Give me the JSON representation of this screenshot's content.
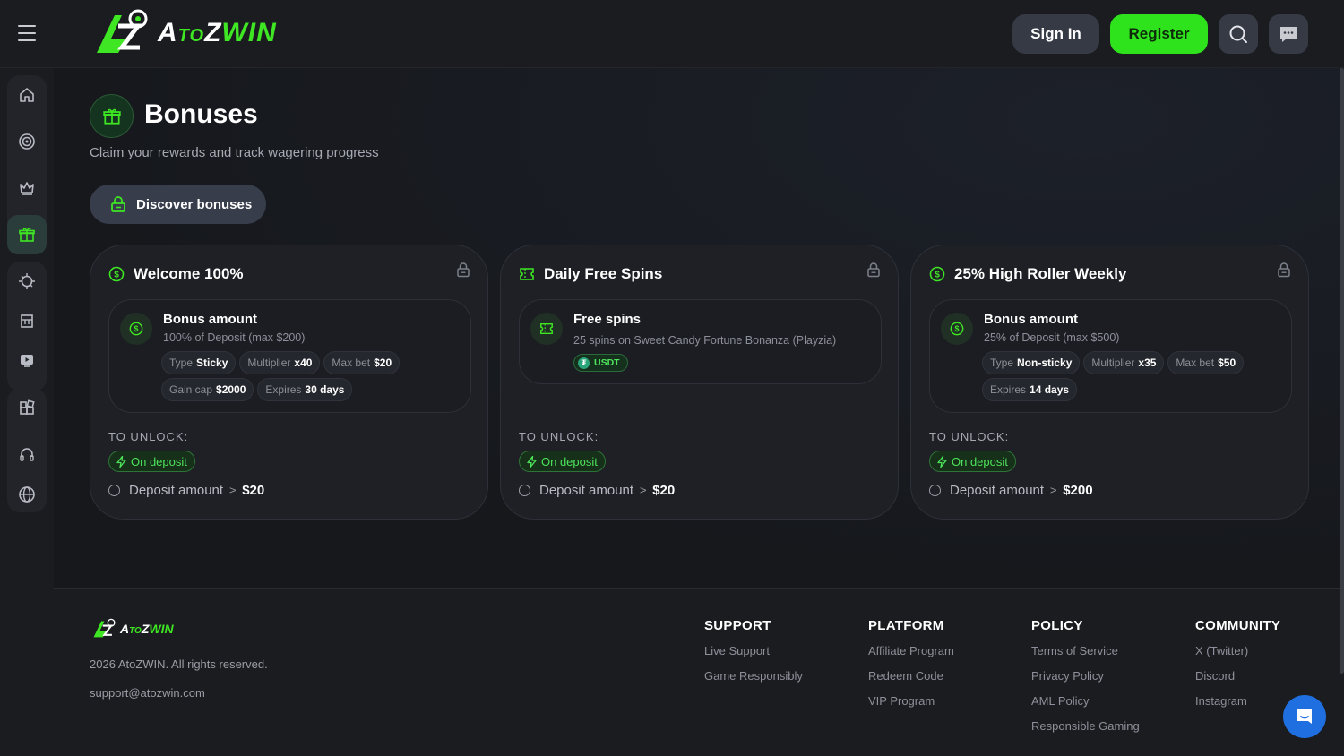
{
  "header": {
    "logo": {
      "part1": "A",
      "part2": "TO",
      "part3": "Z",
      "part4": "WIN"
    },
    "signin_label": "Sign In",
    "register_label": "Register"
  },
  "sidebar": {
    "items": [
      "home-icon",
      "target-icon",
      "crown-icon",
      "gift-icon",
      "sports-icon",
      "slots-icon",
      "live-icon",
      "grid-icon",
      "support-icon",
      "globe-icon"
    ],
    "active": "gift-icon"
  },
  "page": {
    "title": "Bonuses",
    "subtitle": "Claim your rewards and track wagering progress",
    "discover_label": "Discover bonuses"
  },
  "cards": [
    {
      "title": "Welcome 100%",
      "inner_title": "Bonus amount",
      "inner_sub": "100% of Deposit (max $200)",
      "chips": [
        {
          "label": "Type",
          "value": "Sticky"
        },
        {
          "label": "Multiplier",
          "value": "x40"
        },
        {
          "label": "Max bet",
          "value": "$20"
        },
        {
          "label": "Gain cap",
          "value": "$2000"
        },
        {
          "label": "Expires",
          "value": "30 days"
        }
      ],
      "unlock_label": "TO UNLOCK:",
      "deposit_badge": "On deposit",
      "req_label": "Deposit amount",
      "req_symbol": "≥",
      "req_value": "$20"
    },
    {
      "title": "Daily Free Spins",
      "inner_title": "Free spins",
      "inner_sub": "25 spins on Sweet Candy Fortune Bonanza (Playzia)",
      "currency": "USDT",
      "unlock_label": "TO UNLOCK:",
      "deposit_badge": "On deposit",
      "req_label": "Deposit amount",
      "req_symbol": "≥",
      "req_value": "$20"
    },
    {
      "title": "25% High Roller Weekly",
      "inner_title": "Bonus amount",
      "inner_sub": "25% of Deposit (max $500)",
      "chips": [
        {
          "label": "Type",
          "value": "Non-sticky"
        },
        {
          "label": "Multiplier",
          "value": "x35"
        },
        {
          "label": "Max bet",
          "value": "$50"
        },
        {
          "label": "Expires",
          "value": "14 days"
        }
      ],
      "unlock_label": "TO UNLOCK:",
      "deposit_badge": "On deposit",
      "req_label": "Deposit amount",
      "req_symbol": "≥",
      "req_value": "$200"
    }
  ],
  "footer": {
    "copyright": "2026 AtoZWIN. All rights reserved.",
    "email": "support@atozwin.com",
    "columns": [
      {
        "title": "SUPPORT",
        "links": [
          "Live Support",
          "Game Responsibly"
        ]
      },
      {
        "title": "PLATFORM",
        "links": [
          "Affiliate Program",
          "Redeem Code",
          "VIP Program"
        ]
      },
      {
        "title": "POLICY",
        "links": [
          "Terms of Service",
          "Privacy Policy",
          "AML Policy",
          "Responsible Gaming"
        ]
      },
      {
        "title": "COMMUNITY",
        "links": [
          "X (Twitter)",
          "Discord",
          "Instagram"
        ]
      }
    ]
  },
  "colors": {
    "accent": "#2ee21c",
    "background": "#17191d",
    "card": "#1e2026"
  }
}
